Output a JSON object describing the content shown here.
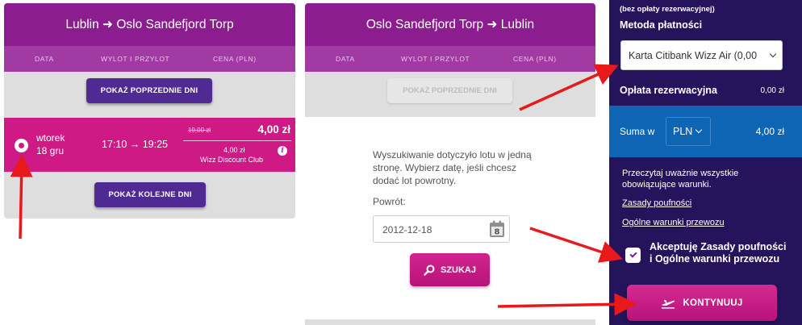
{
  "outbound": {
    "title": "Lublin ➜ Oslo Sandefjord Torp",
    "columns": [
      "DATA",
      "WYLOT I PRZYLOT",
      "CENA (PLN)"
    ],
    "prev_button": "POKAŻ POPRZEDNIE DNI",
    "next_button": "POKAŻ KOLEJNE DNI",
    "flight": {
      "day": "wtorek",
      "date": "18 gru",
      "times": "17:10 → 19:25",
      "old_price": "19,00 zł",
      "price": "4,00 zł",
      "club_price": "4,00 zł",
      "club_name": "Wizz Discount Club",
      "info_icon": "i"
    }
  },
  "return": {
    "title": "Oslo Sandefjord Torp ➜ Lublin",
    "columns": [
      "DATA",
      "WYLOT I PRZYLOT",
      "CENA (PLN)"
    ],
    "prev_button": "POKAŻ POPRZEDNIE DNI",
    "message": "Wyszukiwanie dotyczyło lotu w jedną stronę. Wybierz datę, jeśli chcesz dodać lot powrotny.",
    "return_label": "Powrót:",
    "date_value": "2012-12-18",
    "calendar_day": "8",
    "search_button": "SZUKAJ"
  },
  "summary": {
    "no_fee_note": "(bez opłaty rezerwacyjnej)",
    "payment_label": "Metoda płatności",
    "payment_value": "Karta Citibank Wizz Air (0,00",
    "booking_fee_label": "Opłata rezerwacyjna",
    "booking_fee_value": "0,00 zł",
    "total_label": "Suma w",
    "currency": "PLN",
    "total_value": "4,00 zł",
    "terms_text": "Przeczytaj uważnie wszystkie obowiązujące warunki.",
    "privacy_link": "Zasady poufności",
    "conditions_link": "Ogólne warunki przewozu",
    "accept_label": "Akceptuję Zasady poufności i Ogólne warunki przewozu",
    "accepted": true,
    "continue_button": "KONTYNUUJ"
  },
  "icons": {
    "calendar": "calendar-icon",
    "search": "magnifier-icon",
    "continue": "plane-icon",
    "info": "info-icon"
  },
  "colors": {
    "header_purple": "#8b1d8e",
    "selected_row": "#cf1a85",
    "dark_button": "#4e2a92",
    "sidebar": "#25135c",
    "total_bar": "#0d65b3",
    "arrow_red": "#e8191b"
  }
}
